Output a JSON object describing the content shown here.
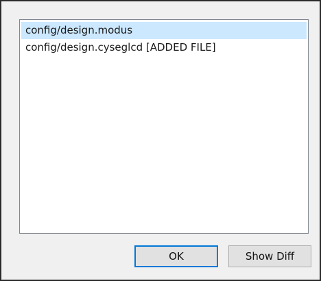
{
  "file_list": {
    "items": [
      {
        "label": "config/design.modus",
        "selected": true
      },
      {
        "label": "config/design.cyseglcd [ADDED FILE]",
        "selected": false
      }
    ]
  },
  "buttons": {
    "ok_label": "OK",
    "show_diff_label": "Show Diff"
  },
  "colors": {
    "selection": "#cce8ff",
    "default_button_border": "#0078d7",
    "dialog_background": "#f0f0f0"
  }
}
